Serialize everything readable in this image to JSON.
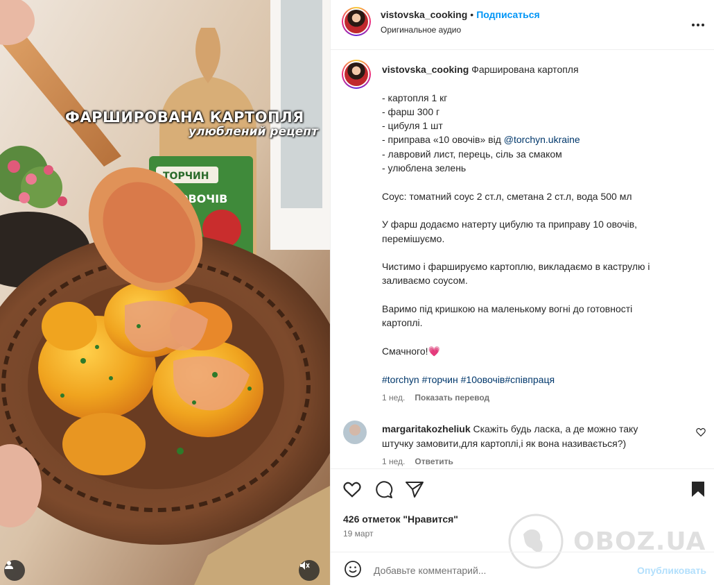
{
  "media": {
    "overlay_title": "ФАРШИРОВАНА КАРТОПЛЯ",
    "overlay_subtitle": "улюблений рецепт",
    "package_brand": "ТОРЧИН",
    "package_label": "10 ОВОЧІВ",
    "user_icon": "user-icon",
    "mute_icon": "speaker-muted-icon"
  },
  "header": {
    "username": "vistovska_cooking",
    "separator": "•",
    "follow_label": "Подписаться",
    "audio_label": "Оригинальное аудио",
    "more_icon": "more-icon"
  },
  "caption": {
    "username": "vistovska_cooking",
    "title": "Фарширована картопля",
    "lines": [
      "- картопля 1 кг",
      "- фарш 300 г",
      "- цибуля 1 шт",
      "- приправа «10 овочів» від ",
      "- лавровий лист, перець, сіль за смаком",
      "- улюблена зелень",
      "",
      "Соус: томатний соус 2 ст.л, сметана 2 ст.л, вода 500 мл",
      "",
      "У фарш додаємо натерту цибулю та приправу 10 овочів,",
      "перемішуємо.",
      "",
      "Чистимо і фаршируємо картоплю, викладаємо в каструлю і",
      "заливаємо соусом.",
      "",
      "Варимо під кришкою на маленькому вогні до готовності",
      "картоплі.",
      "",
      "Смачного!"
    ],
    "mention": "@torchyn.ukraine",
    "heart_emoji": "💗",
    "hashtags": "#torchyn #торчин #10овочів#співпраця",
    "time": "1 нед.",
    "translate_label": "Показать перевод"
  },
  "comment": {
    "username": "margaritakozheliuk",
    "text_line1": "Скажіть будь ласка, а де можно таку",
    "text_line2": "штучку замовити,для картоплі,і як вона називається?)",
    "time": "1 нед.",
    "reply_label": "Ответить",
    "like_icon": "heart-outline-icon"
  },
  "actions": {
    "likes": "426 отметок \"Нравится\"",
    "date": "19 март"
  },
  "add_comment": {
    "placeholder": "Добавьте комментарий...",
    "post_label": "Опубликовать"
  },
  "watermark": {
    "text": "OBOZ.UA"
  },
  "colors": {
    "accent": "#0095f6",
    "link": "#00376b",
    "muted": "#737373",
    "post_disabled": "#b2dffc",
    "border": "#efefef"
  }
}
